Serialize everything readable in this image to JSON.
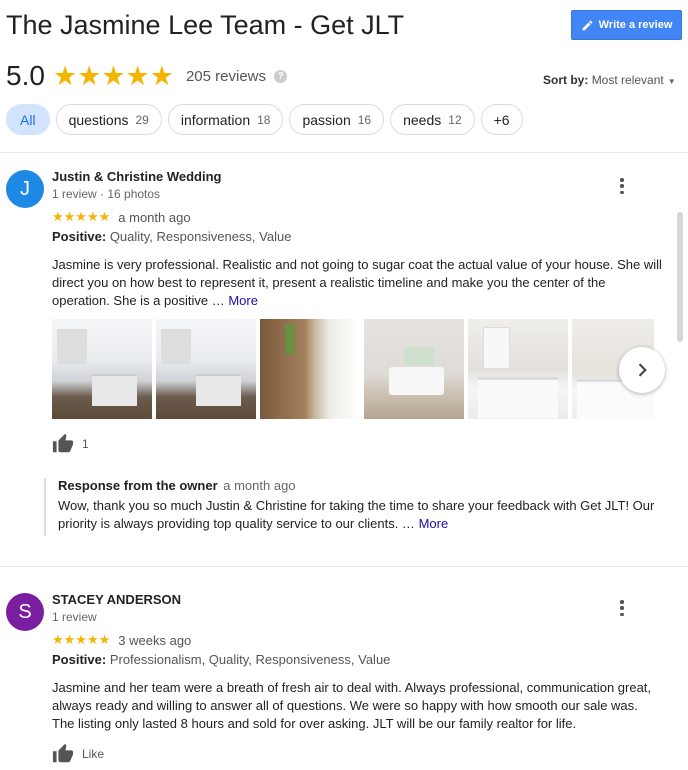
{
  "header": {
    "title": "The Jasmine Lee Team - Get JLT",
    "write_review_label": "Write a review"
  },
  "summary": {
    "rating": "5.0",
    "stars": "★★★★★",
    "review_count": "205 reviews",
    "help": "?"
  },
  "sort": {
    "label": "Sort by:",
    "value": "Most relevant"
  },
  "chips": [
    {
      "label": "All",
      "count": ""
    },
    {
      "label": "questions",
      "count": "29"
    },
    {
      "label": "information",
      "count": "18"
    },
    {
      "label": "passion",
      "count": "16"
    },
    {
      "label": "needs",
      "count": "12"
    },
    {
      "label": "+6",
      "count": ""
    }
  ],
  "reviews": [
    {
      "initial": "J",
      "avatar_color": "#1e88e5",
      "author": "Justin & Christine Wedding",
      "meta": "1 review · 16 photos",
      "stars": "★★★★★",
      "date": "a month ago",
      "positive_label": "Positive:",
      "positive_text": "Quality, Responsiveness, Value",
      "text": "Jasmine is very professional. Realistic and not going to sugar coat the actual value of your house. She will direct you on how best to represent it, present a realistic timeline and make you the center of the operation. She is a positive …",
      "more": "More",
      "likes": "1",
      "owner_response": {
        "label": "Response from the owner",
        "date": "a month ago",
        "text": "Wow, thank you so much Justin & Christine for taking the time to share your feedback with Get JLT! Our priority is always providing top quality service to our clients. …",
        "more": "More"
      }
    },
    {
      "initial": "S",
      "avatar_color": "#7b1fa2",
      "author": "STACEY ANDERSON",
      "meta": "1 review",
      "stars": "★★★★★",
      "date": "3 weeks ago",
      "positive_label": "Positive:",
      "positive_text": "Professionalism, Quality, Responsiveness, Value",
      "text": "Jasmine and her team were a breath of fresh air to deal with. Always professional, communication great, always ready and willing to answer all of questions. We were so happy with how smooth our sale was. The listing only lasted 8 hours and sold for over asking. JLT will be our family realtor for life.",
      "likes": "Like"
    }
  ]
}
